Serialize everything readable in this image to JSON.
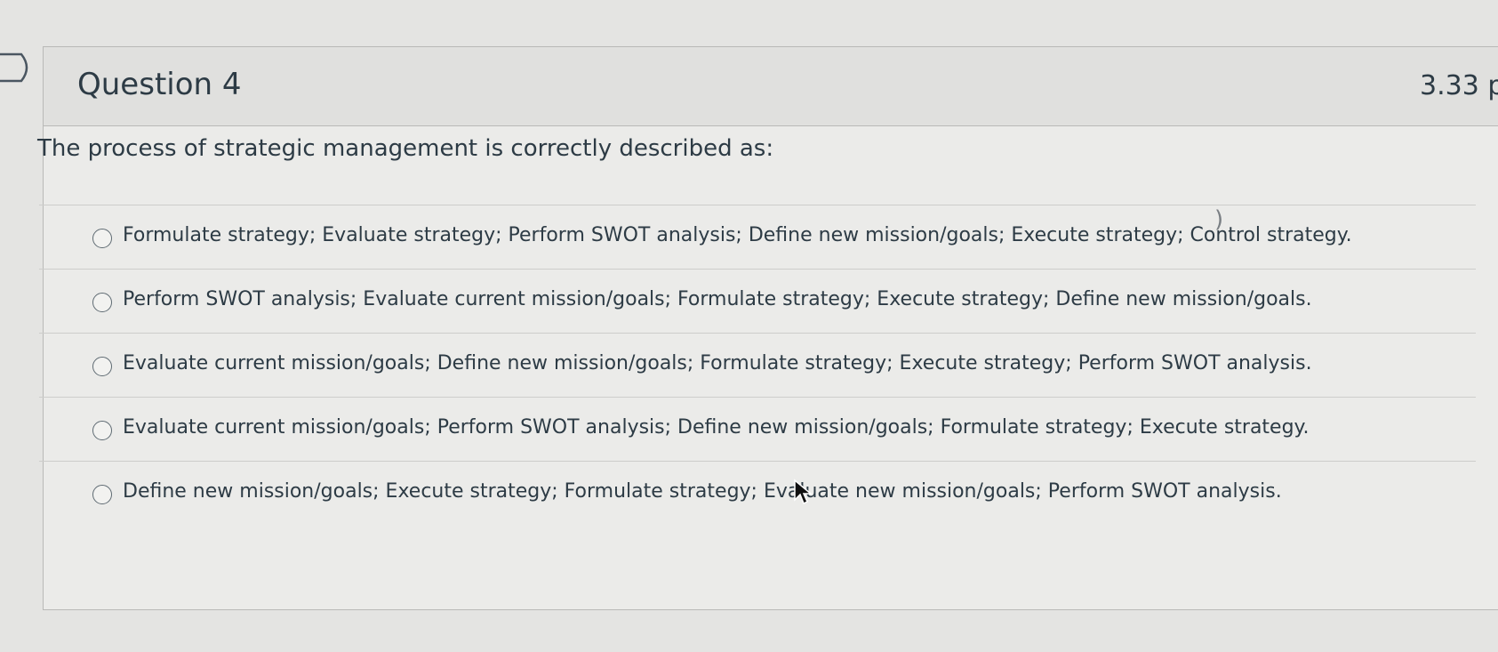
{
  "question": {
    "title": "Question 4",
    "points": "3.33 p",
    "text": "The process of strategic management is correctly described as:",
    "answers": [
      {
        "label": "Formulate strategy; Evaluate strategy; Perform SWOT analysis; Define new mission/goals; Execute strategy; Control strategy.",
        "selected": false
      },
      {
        "label": "Perform SWOT analysis; Evaluate current mission/goals; Formulate strategy; Execute strategy; Define new mission/goals.",
        "selected": false
      },
      {
        "label": "Evaluate current mission/goals; Define new mission/goals; Formulate strategy; Execute strategy; Perform SWOT analysis.",
        "selected": false
      },
      {
        "label": "Evaluate current mission/goals; Perform SWOT analysis; Define new mission/goals; Formulate strategy; Execute strategy.",
        "selected": false
      },
      {
        "label": "Define new mission/goals; Execute strategy; Formulate strategy; Evaluate new mission/goals; Perform SWOT analysis.",
        "selected": false
      }
    ]
  },
  "icons": {
    "flag": "bookmark-flag-icon",
    "cursor": "mouse-pointer-icon"
  },
  "colors": {
    "background": "#e4e4e2",
    "header": "#e0e0de",
    "text": "#2d3b45",
    "border": "#b9b9b7"
  }
}
